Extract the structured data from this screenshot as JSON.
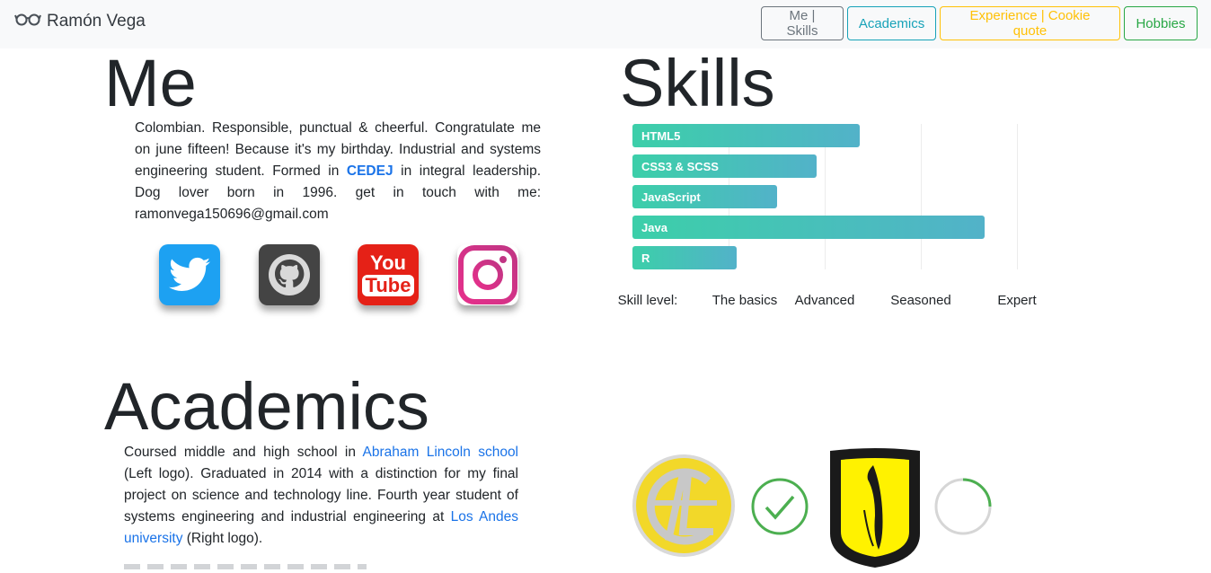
{
  "brand": {
    "name": "Ramón Vega",
    "icon": "glasses-icon"
  },
  "nav": {
    "me_skills": "Me | Skills",
    "academics": "Academics",
    "experience": "Experience | Cookie quote",
    "hobbies": "Hobbies"
  },
  "colors": {
    "me_skills": "#6c757d",
    "academics": "#17a2b8",
    "experience": "#ffc107",
    "hobbies": "#28a745",
    "link": "#1a73e8"
  },
  "me": {
    "title": "Me",
    "text_1": "Colombian. Responsible, punctual & cheerful. Congratulate me on june fifteen! Because it's my birthday. Industrial and systems engineering student. Formed in ",
    "link_cedej": "CEDEJ",
    "text_2": " in integral leadership. Dog lover born in 1996. get in touch with me: ramonvega150696@gmail.com",
    "social": [
      "twitter-icon",
      "github-icon",
      "youtube-icon",
      "instagram-icon"
    ]
  },
  "skills": {
    "title": "Skills",
    "chart_data": {
      "type": "bar",
      "orientation": "horizontal",
      "categories": [
        "HTML5",
        "CSS3 & SCSS",
        "JavaScript",
        "Java",
        "R"
      ],
      "values": [
        1.18,
        0.96,
        0.75,
        1.83,
        0.54
      ],
      "xlabel": "Skill level:",
      "ticks": [
        "The basics",
        "Advanced",
        "Seasoned",
        "Expert"
      ],
      "tick_values": [
        0.5,
        1.0,
        1.5,
        2.0
      ],
      "xlim": [
        0,
        2.0
      ],
      "grid": true
    }
  },
  "academics": {
    "title": "Academics",
    "text_1": "Coursed middle and high school in ",
    "link_school": "Abraham Lincoln school",
    "text_2": " (Left logo). Graduated in 2014 with a distinction for my final project on science and technology line. Fourth year student of systems engineering and industrial engineering at ",
    "link_uni": "Los Andes university",
    "text_3": " (Right logo).",
    "logos": [
      "abraham-lincoln-logo",
      "check-circle-icon",
      "los-andes-logo",
      "loading-circle-icon"
    ]
  }
}
